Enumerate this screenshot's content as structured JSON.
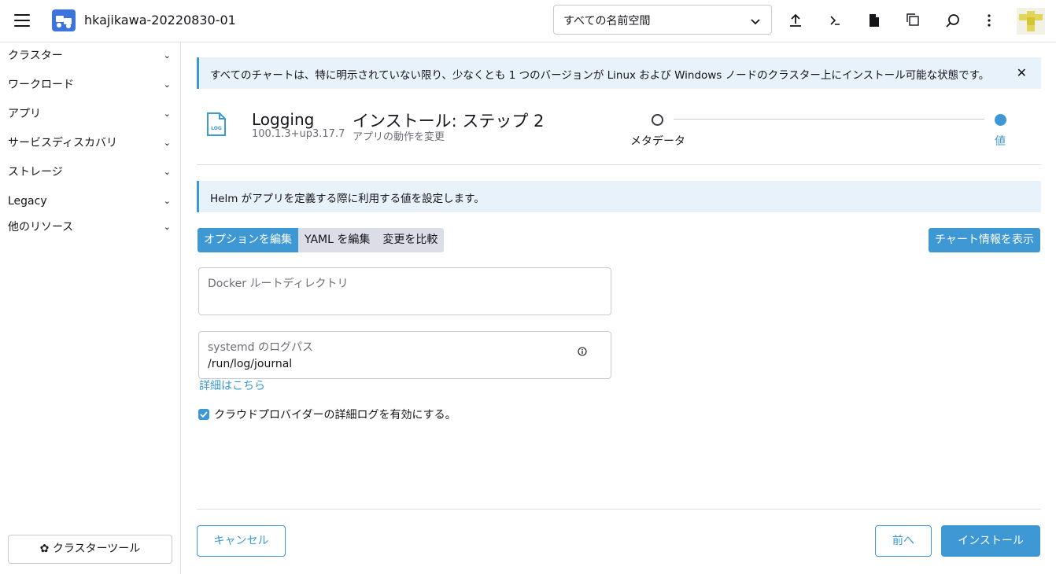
{
  "header": {
    "cluster_name": "hkajikawa-20220830-01",
    "namespace_select": "すべての名前空間"
  },
  "sidebar": {
    "items": [
      {
        "label": "クラスター"
      },
      {
        "label": "ワークロード"
      },
      {
        "label": "アプリ"
      },
      {
        "label": "サービスディスカバリ"
      },
      {
        "label": "ストレージ"
      },
      {
        "label": "Legacy"
      },
      {
        "label": "他のリソース"
      }
    ],
    "cluster_tools": "クラスターツール"
  },
  "banner": {
    "text": "すべてのチャートは、特に明示されていない限り、少なくとも 1 つのバージョンが Linux および Windows ノードのクラスター上にインストール可能な状態です。"
  },
  "app": {
    "icon_label": "LOG",
    "name": "Logging",
    "version": "100.1.3+up3.17.7",
    "step_title": "インストール: ステップ 2",
    "step_subtitle": "アプリの動作を変更"
  },
  "steps": [
    {
      "label": "メタデータ",
      "state": "done"
    },
    {
      "label": "値",
      "state": "current"
    }
  ],
  "info": {
    "text": "Helm がアプリを定義する際に利用する値を設定します。"
  },
  "tabs": [
    {
      "label": "オプションを編集",
      "active": true
    },
    {
      "label": "YAML を編集",
      "active": false
    },
    {
      "label": "変更を比較",
      "active": false
    }
  ],
  "chart_info_button": "チャート情報を表示",
  "fields": {
    "docker_root": {
      "label": "Docker ルートディレクトリ",
      "value": ""
    },
    "systemd_log": {
      "label": "systemd のログパス",
      "value": "/run/log/journal"
    }
  },
  "more_info_link": "詳細はこちら",
  "checkbox": {
    "label": "クラウドプロバイダーの詳細ログを有効にする。",
    "checked": true
  },
  "footer": {
    "cancel": "キャンセル",
    "previous": "前へ",
    "install": "インストール"
  },
  "colors": {
    "accent": "#3d98d3",
    "brand": "#3d74dc"
  }
}
